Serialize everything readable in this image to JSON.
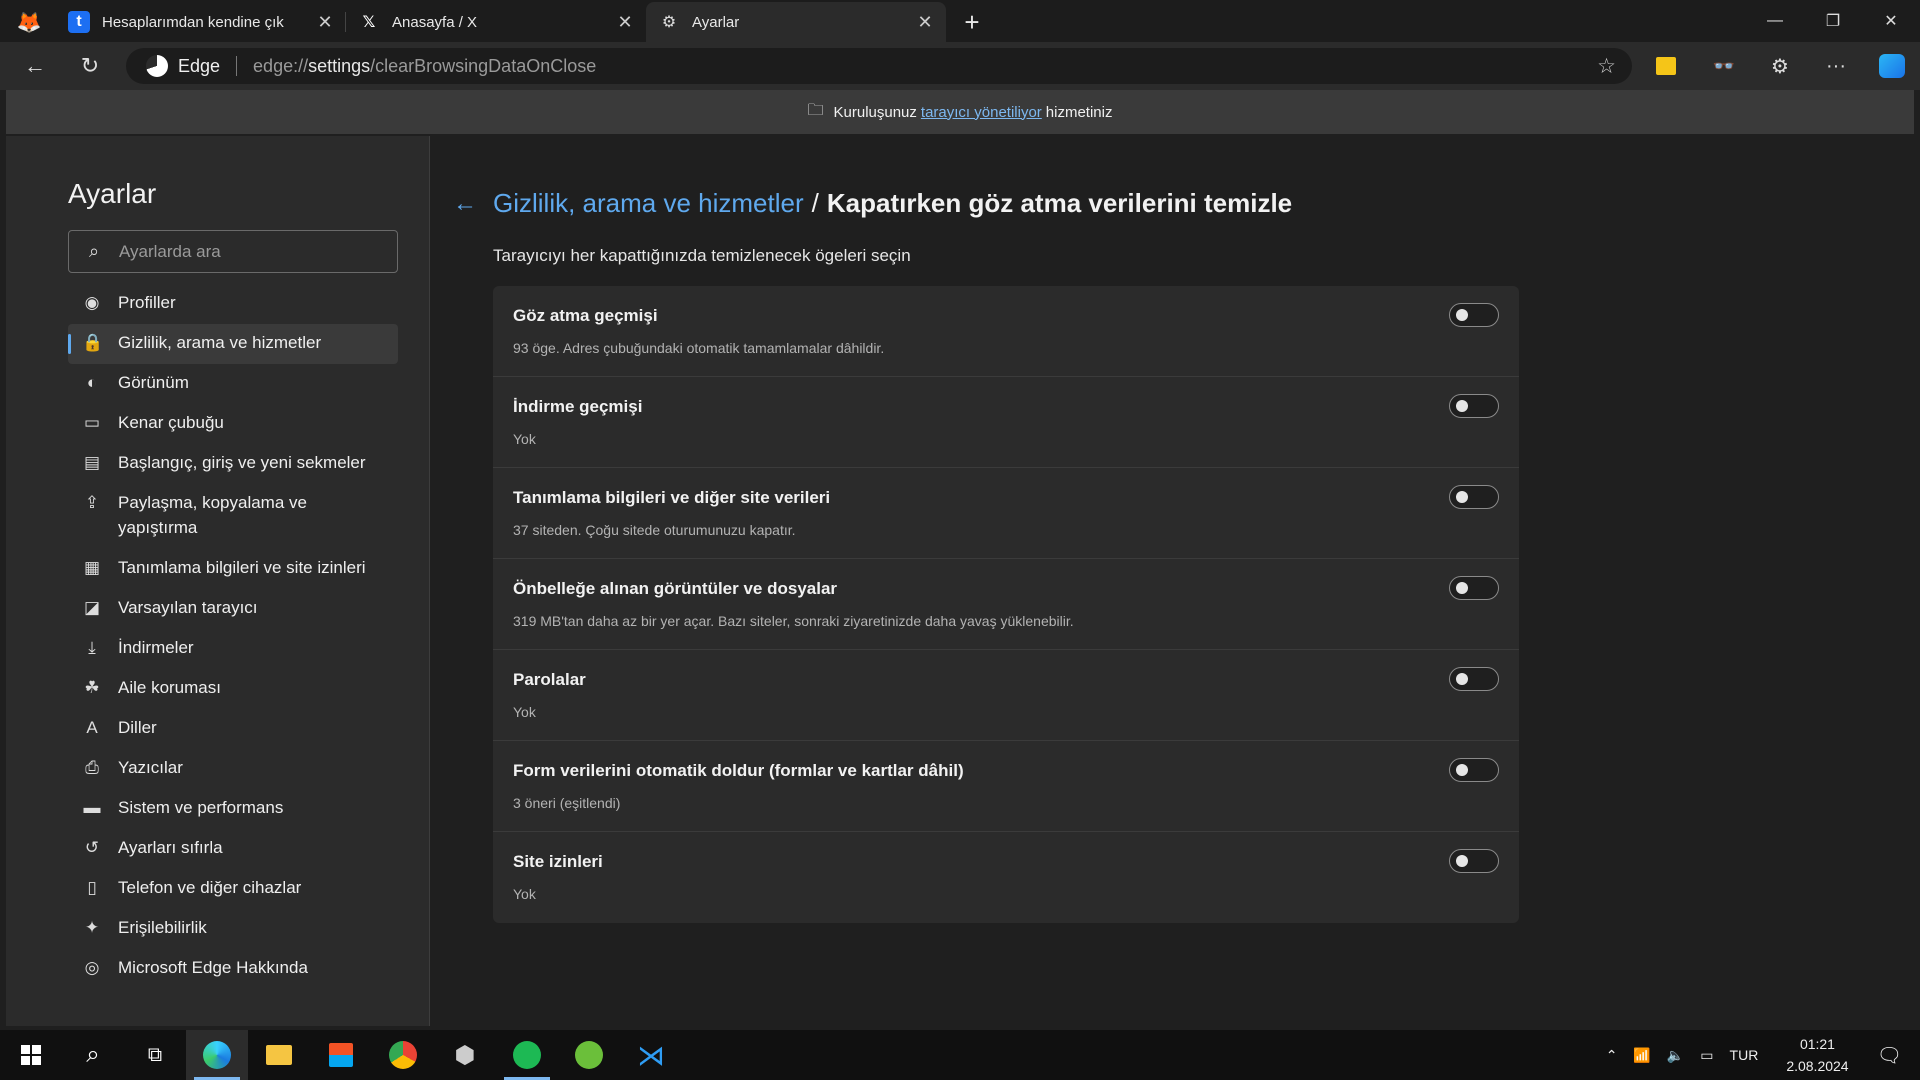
{
  "tabs": [
    {
      "title": "Hesaplarımdan kendine çık",
      "favicon": "t",
      "fav_bg": "#1d6ff2",
      "close": "✕"
    },
    {
      "title": "Anasayfa / X",
      "favicon": "𝕏",
      "fav_bg": "transparent",
      "close": "✕"
    },
    {
      "title": "Ayarlar",
      "favicon": "⚙",
      "fav_bg": "transparent",
      "close": "✕"
    }
  ],
  "new_tab_label": "+",
  "window_controls": {
    "minimize": "—",
    "restore": "❐",
    "close": "✕"
  },
  "toolbar": {
    "brand": "Edge",
    "url_prefix": "edge://",
    "url_main": "settings",
    "url_rest": "/clearBrowsingDataOnClose",
    "star": "☆",
    "more": "···"
  },
  "infobar": {
    "prefix": "Kuruluşunuz",
    "link": "tarayıcı yönetiliyor",
    "suffix": "hizmetiniz"
  },
  "sidebar": {
    "title": "Ayarlar",
    "search_placeholder": "Ayarlarda ara",
    "items": [
      {
        "label": "Profiller",
        "icon": "◉"
      },
      {
        "label": "Gizlilik, arama ve hizmetler",
        "icon": "🔒"
      },
      {
        "label": "Görünüm",
        "icon": "◐"
      },
      {
        "label": "Kenar çubuğu",
        "icon": "▭"
      },
      {
        "label": "Başlangıç, giriş ve yeni sekmeler",
        "icon": "▤"
      },
      {
        "label": "Paylaşma, kopyalama ve yapıştırma",
        "icon": "⇪"
      },
      {
        "label": "Tanımlama bilgileri ve site izinleri",
        "icon": "▦"
      },
      {
        "label": "Varsayılan tarayıcı",
        "icon": "◪"
      },
      {
        "label": "İndirmeler",
        "icon": "⤓"
      },
      {
        "label": "Aile koruması",
        "icon": "☘"
      },
      {
        "label": "Diller",
        "icon": "A"
      },
      {
        "label": "Yazıcılar",
        "icon": "⎙"
      },
      {
        "label": "Sistem ve performans",
        "icon": "▬"
      },
      {
        "label": "Ayarları sıfırla",
        "icon": "↺"
      },
      {
        "label": "Telefon ve diğer cihazlar",
        "icon": "▯"
      },
      {
        "label": "Erişilebilirlik",
        "icon": "✦"
      },
      {
        "label": "Microsoft Edge Hakkında",
        "icon": "◎"
      }
    ]
  },
  "main": {
    "breadcrumb_link": "Gizlilik, arama ve hizmetler",
    "breadcrumb_sep": "/",
    "breadcrumb_current": "Kapatırken göz atma verilerini temizle",
    "subtitle": "Tarayıcıyı her kapattığınızda temizlenecek ögeleri seçin",
    "rows": [
      {
        "title": "Göz atma geçmişi",
        "desc": "93 öge. Adres çubuğundaki otomatik tamamlamalar dâhildir.",
        "on": false
      },
      {
        "title": "İndirme geçmişi",
        "desc": "Yok",
        "on": false
      },
      {
        "title": "Tanımlama bilgileri ve diğer site verileri",
        "desc": "37 siteden. Çoğu sitede oturumunuzu kapatır.",
        "on": false
      },
      {
        "title": "Önbelleğe alınan görüntüler ve dosyalar",
        "desc": "319 MB'tan daha az bir yer açar. Bazı siteler, sonraki ziyaretinizde daha yavaş yüklenebilir.",
        "on": false
      },
      {
        "title": "Parolalar",
        "desc": "Yok",
        "on": false
      },
      {
        "title": "Form verilerini otomatik doldur (formlar ve kartlar dâhil)",
        "desc": "3 öneri (eşitlendi)",
        "on": false
      },
      {
        "title": "Site izinleri",
        "desc": "Yok",
        "on": false
      }
    ]
  },
  "taskbar": {
    "lang": "TUR",
    "time": "01:21",
    "date": "2.08.2024",
    "apps": [
      "windows-start",
      "search",
      "task-view",
      "edge",
      "file-explorer",
      "microsoft-store",
      "chrome",
      "app-hex",
      "spotify",
      "utorrent",
      "vscode"
    ]
  }
}
